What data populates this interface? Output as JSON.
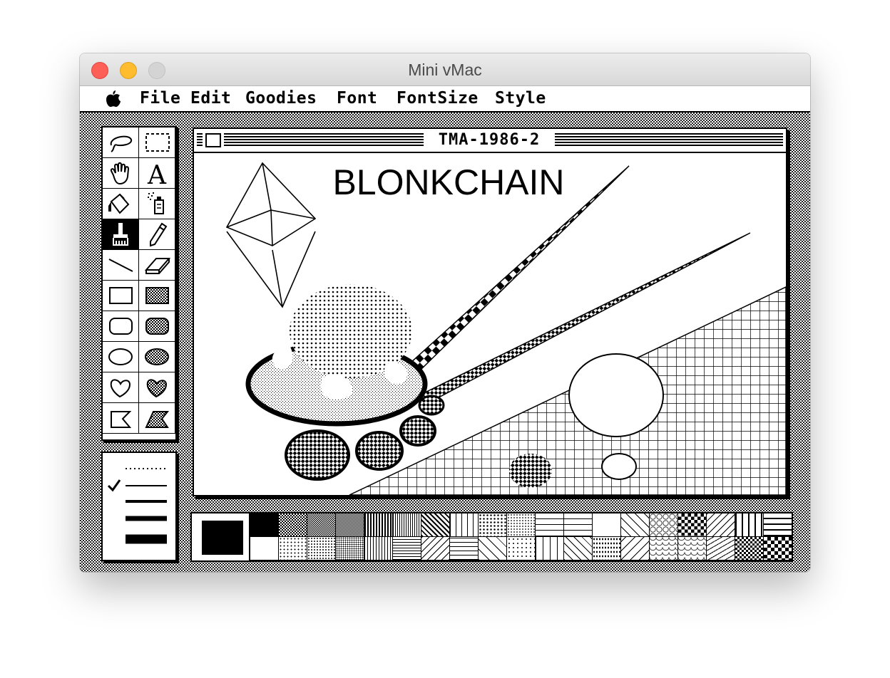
{
  "window": {
    "title": "Mini vMac",
    "buttons": [
      "close",
      "minimize",
      "zoom"
    ]
  },
  "menubar": {
    "apple_icon": "apple-icon",
    "items": [
      "File",
      "Edit",
      "Goodies",
      "Font",
      "FontSize",
      "Style"
    ]
  },
  "tools": {
    "items": [
      {
        "name": "lasso",
        "icon": "lasso-icon"
      },
      {
        "name": "selection-rectangle",
        "icon": "selection-rect-icon"
      },
      {
        "name": "grabber",
        "icon": "hand-icon"
      },
      {
        "name": "text",
        "icon": "text-icon",
        "glyph": "A"
      },
      {
        "name": "paint-bucket",
        "icon": "paint-bucket-icon"
      },
      {
        "name": "spray-can",
        "icon": "spray-can-icon"
      },
      {
        "name": "paintbrush",
        "icon": "paintbrush-icon",
        "selected": true
      },
      {
        "name": "pencil",
        "icon": "pencil-icon"
      },
      {
        "name": "line",
        "icon": "line-icon"
      },
      {
        "name": "eraser",
        "icon": "eraser-icon"
      },
      {
        "name": "rectangle",
        "icon": "rectangle-icon"
      },
      {
        "name": "filled-rectangle",
        "icon": "filled-rectangle-icon"
      },
      {
        "name": "rounded-rectangle",
        "icon": "rounded-rectangle-icon"
      },
      {
        "name": "filled-rounded-rectangle",
        "icon": "filled-rounded-rectangle-icon"
      },
      {
        "name": "oval",
        "icon": "oval-icon"
      },
      {
        "name": "filled-oval",
        "icon": "filled-oval-icon"
      },
      {
        "name": "freeform",
        "icon": "freeform-icon"
      },
      {
        "name": "filled-freeform",
        "icon": "filled-freeform-icon"
      },
      {
        "name": "polygon",
        "icon": "polygon-icon"
      },
      {
        "name": "filled-polygon",
        "icon": "filled-polygon-icon"
      }
    ]
  },
  "line_widths": {
    "options": [
      "dotted",
      "1",
      "2",
      "3",
      "4"
    ],
    "selected": "1",
    "check_icon": "checkmark-icon"
  },
  "document": {
    "title": "TMA-1986-2",
    "canvas_text": "BLONKCHAIN"
  },
  "patterns": {
    "current_pattern": "black",
    "count": 38
  }
}
